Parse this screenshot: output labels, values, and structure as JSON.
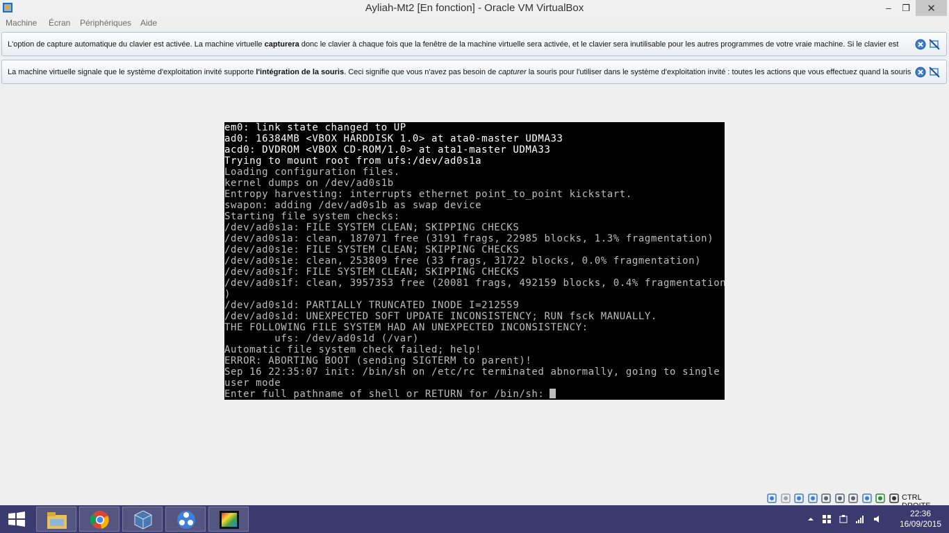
{
  "window": {
    "title": "Ayliah-Mt2 [En fonction] - Oracle VM VirtualBox",
    "minimize": "–",
    "maximize": "❐",
    "close": "✕"
  },
  "menu": {
    "items": [
      "Machine",
      "Écran",
      "Périphériques",
      "Aide"
    ]
  },
  "banners": [
    {
      "pre": "L'option de capture automatique du clavier est activée. La machine virtuelle ",
      "bold": "capturera",
      "post": " donc le clavier à chaque fois que la fenêtre de la machine virtuelle sera activée, et le clavier sera inutilisable pour les autres programmes de votre vraie machine. Si le clavier est"
    },
    {
      "pre": "La machine virtuelle signale que le système d'exploitation invité supporte ",
      "bold": "l'intégration de la souris",
      "mid": ". Ceci signifie que vous n'avez pas besoin de ",
      "italic": "capturer",
      "post": " la souris pour l'utiliser dans le système d'exploitation invité : toutes les actions que vous effectuez quand la souris"
    }
  ],
  "console": {
    "lines": [
      "em0: link state changed to UP",
      "ad0: 16384MB <VBOX HARDDISK 1.0> at ata0-master UDMA33",
      "acd0: DVDROM <VBOX CD-ROM/1.0> at ata1-master UDMA33",
      "Trying to mount root from ufs:/dev/ad0s1a",
      "Loading configuration files.",
      "kernel dumps on /dev/ad0s1b",
      "Entropy harvesting: interrupts ethernet point_to_point kickstart.",
      "swapon: adding /dev/ad0s1b as swap device",
      "Starting file system checks:",
      "/dev/ad0s1a: FILE SYSTEM CLEAN; SKIPPING CHECKS",
      "/dev/ad0s1a: clean, 187071 free (3191 frags, 22985 blocks, 1.3% fragmentation)",
      "/dev/ad0s1e: FILE SYSTEM CLEAN; SKIPPING CHECKS",
      "/dev/ad0s1e: clean, 253809 free (33 frags, 31722 blocks, 0.0% fragmentation)",
      "/dev/ad0s1f: FILE SYSTEM CLEAN; SKIPPING CHECKS",
      "/dev/ad0s1f: clean, 3957353 free (20081 frags, 492159 blocks, 0.4% fragmentation",
      ")",
      "/dev/ad0s1d: PARTIALLY TRUNCATED INODE I=212559",
      "/dev/ad0s1d: UNEXPECTED SOFT UPDATE INCONSISTENCY; RUN fsck MANUALLY.",
      "THE FOLLOWING FILE SYSTEM HAD AN UNEXPECTED INCONSISTENCY:",
      "        ufs: /dev/ad0s1d (/var)",
      "Automatic file system check failed; help!",
      "ERROR: ABORTING BOOT (sending SIGTERM to parent)!",
      "Sep 16 22:35:07 init: /bin/sh on /etc/rc terminated abnormally, going to single",
      "user mode",
      "Enter full pathname of shell or RETURN for /bin/sh: "
    ],
    "bright_lines": [
      0,
      1,
      2,
      3
    ]
  },
  "statusbar": {
    "host_key": "CTRL DROITE",
    "icons": [
      "hard-disk-icon",
      "optical-drive-icon",
      "usb-icon",
      "shared-folders-icon",
      "display-icon",
      "network-icon",
      "video-capture-icon",
      "virtualization-icon",
      "mouse-integration-icon",
      "keyboard-capture-icon"
    ]
  },
  "taskbar": {
    "apps": [
      "file-explorer-icon",
      "chrome-icon",
      "virtualbox-icon",
      "media-app-icon",
      "video-editor-icon"
    ],
    "time": "22:36",
    "date": "16/09/2015"
  },
  "colors": {
    "taskbar": "#3a3a6e",
    "console_text": "#bdbdbd",
    "console_bright": "#ffffff",
    "banner_border": "#b9c2cc"
  }
}
